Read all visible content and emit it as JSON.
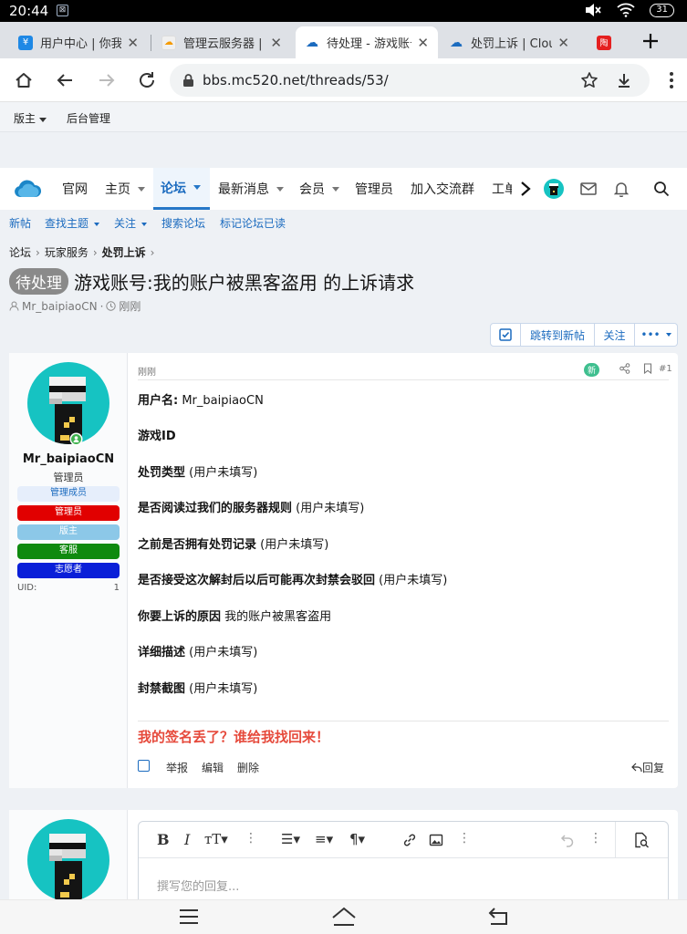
{
  "status_bar": {
    "time": "20:44",
    "battery": "31",
    "app_icon": "grid-icon"
  },
  "tabs": [
    {
      "title": "用户中心 | 你我",
      "favicon": "yen-icon",
      "active": false
    },
    {
      "title": "管理云服务器 | 腾",
      "favicon": "cloud-box-icon",
      "active": false
    },
    {
      "title": "待处理 - 游戏账号",
      "favicon": "cloud-icon",
      "active": true
    },
    {
      "title": "处罚上诉 | Cloud",
      "favicon": "cloud-icon",
      "active": false
    }
  ],
  "pinned_tab_label": "陶",
  "address": {
    "url": "bbs.mc520.net/threads/53/"
  },
  "staff_bar": {
    "moderator": "版主",
    "admin": "后台管理"
  },
  "nav": {
    "items": [
      {
        "label": "官网",
        "caret": false
      },
      {
        "label": "主页",
        "caret": true
      },
      {
        "label": "论坛",
        "caret": true,
        "selected": true
      },
      {
        "label": "最新消息",
        "caret": true
      },
      {
        "label": "会员",
        "caret": true
      },
      {
        "label": "管理员",
        "caret": false
      },
      {
        "label": "加入交流群",
        "caret": false
      },
      {
        "label": "工单",
        "caret": false
      }
    ]
  },
  "subnav": {
    "items": [
      {
        "label": "新帖",
        "caret": false
      },
      {
        "label": "查找主题",
        "caret": true
      },
      {
        "label": "关注",
        "caret": true
      },
      {
        "label": "搜索论坛",
        "caret": false
      },
      {
        "label": "标记论坛已读",
        "caret": false
      }
    ]
  },
  "breadcrumb": {
    "items": [
      "论坛",
      "玩家服务",
      "处罚上诉"
    ]
  },
  "thread": {
    "status": "待处理",
    "title": "游戏账号:我的账户被黑客盗用 的上诉请求",
    "author": "Mr_baipiaoCN",
    "time": "刚刚"
  },
  "thread_buttons": {
    "jump": "跳转到新帖",
    "watch": "关注",
    "more": "•••"
  },
  "post": {
    "date": "刚刚",
    "new_badge": "新",
    "number": "#1",
    "user": {
      "name": "Mr_baipiaoCN",
      "title": "管理员",
      "uid_label": "UID:",
      "uid": "1",
      "badges": [
        {
          "label": "管理成员",
          "bg": "#e6eefb",
          "fg": "#1b6bbf"
        },
        {
          "label": "管理员",
          "bg": "#e10000",
          "fg": "#ffffff"
        },
        {
          "label": "版主",
          "bg": "#8cc8e8",
          "fg": "#ffffff"
        },
        {
          "label": "客服",
          "bg": "#0f8a0f",
          "fg": "#ffffff"
        },
        {
          "label": "志愿者",
          "bg": "#0a1fd8",
          "fg": "#ffffff"
        }
      ]
    },
    "fields": [
      {
        "label": "用户名:",
        "value": " Mr_baipiaoCN"
      },
      {
        "label": "游戏ID",
        "value": ""
      },
      {
        "label": "处罚类型",
        "value": " (用户未填写)"
      },
      {
        "label": "是否阅读过我们的服务器规则",
        "value": " (用户未填写)"
      },
      {
        "label": "之前是否拥有处罚记录",
        "value": " (用户未填写)"
      },
      {
        "label": "是否接受这次解封后以后可能再次封禁会驳回",
        "value": " (用户未填写)"
      },
      {
        "label": "你要上诉的原因",
        "value": " 我的账户被黑客盗用"
      },
      {
        "label": "详细描述",
        "value": " (用户未填写)"
      },
      {
        "label": "封禁截图",
        "value": " (用户未填写)"
      }
    ],
    "signature": "我的签名丢了？谁给我找回来！",
    "actions": {
      "report": "举报",
      "edit": "编辑",
      "delete": "删除",
      "reply": "回复"
    }
  },
  "reply": {
    "placeholder": "撰写您的回复..."
  },
  "colors": {
    "accent": "#1b6bbf",
    "avatar_bg": "#16c3c2",
    "signature": "#e64a3c",
    "new_badge": "#3fbf8f"
  }
}
